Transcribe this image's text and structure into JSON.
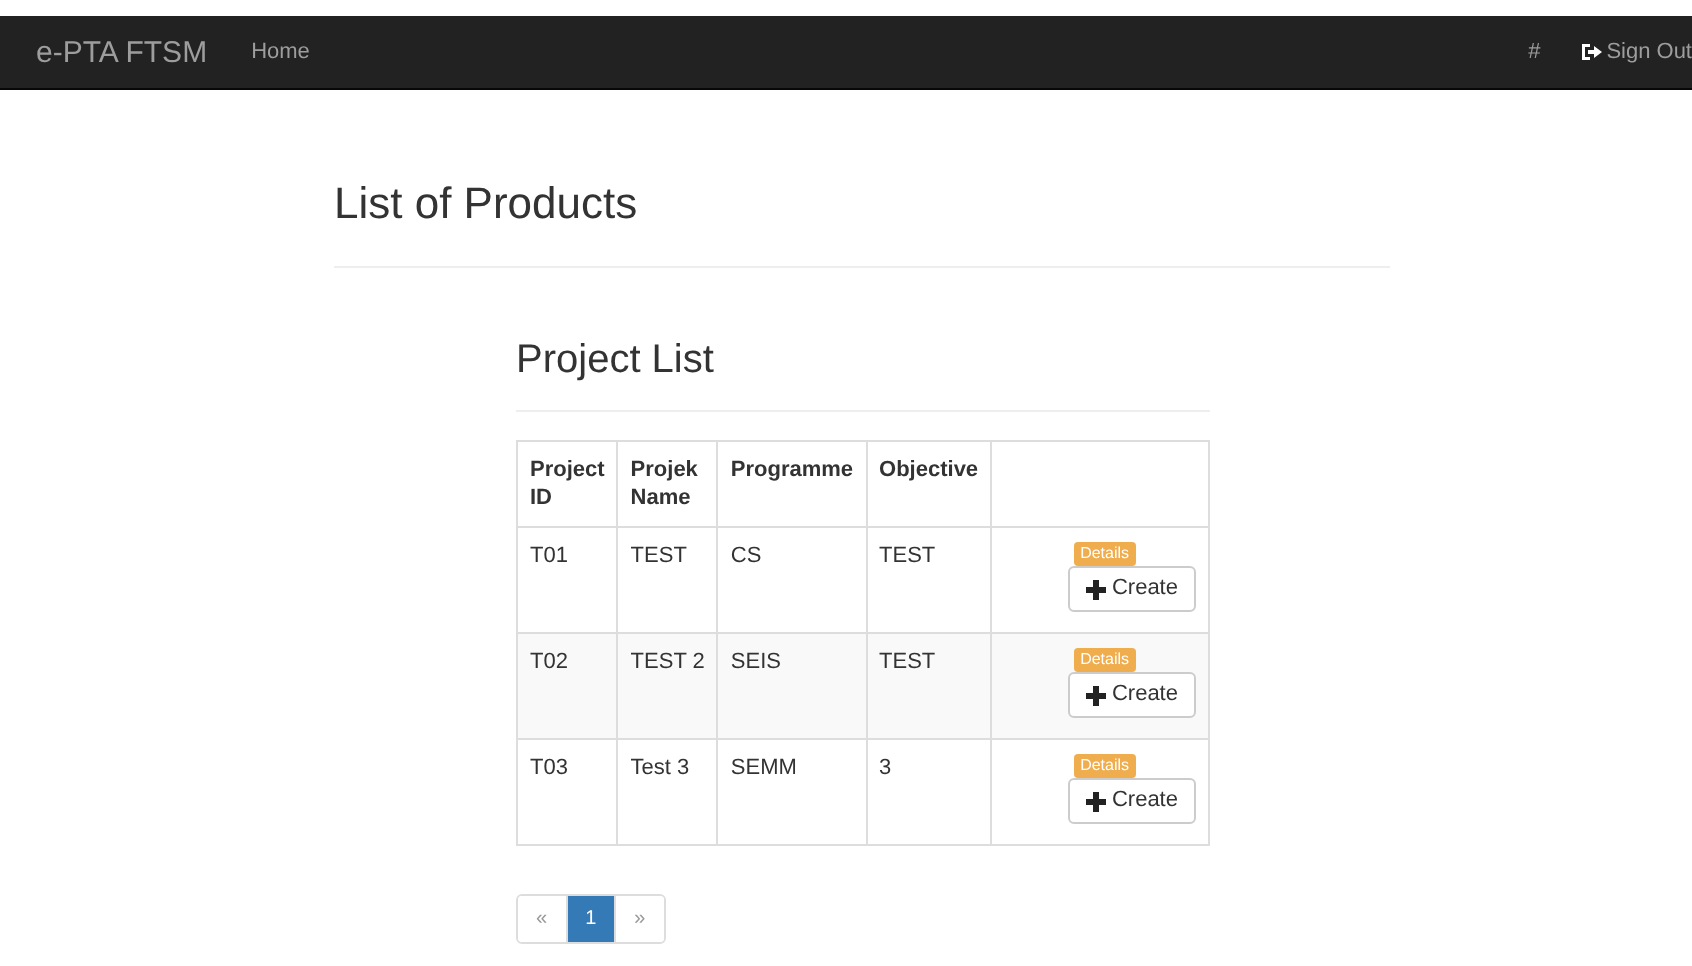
{
  "navbar": {
    "brand": "e-PTA FTSM",
    "links": [
      "Home"
    ],
    "right_links": [
      {
        "kind": "text",
        "label": "#"
      },
      {
        "kind": "signout",
        "label": "Sign Out"
      }
    ]
  },
  "page_title": "List of Products",
  "section_title": "Project List",
  "table": {
    "columns": [
      "Project ID",
      "Projek Name",
      "Programme",
      "Objective"
    ],
    "rows": [
      {
        "cells": [
          "T01",
          "TEST",
          "CS",
          "TEST"
        ],
        "badge": "Details",
        "button": "Create"
      },
      {
        "cells": [
          "T02",
          "TEST 2",
          "SEIS",
          "TEST"
        ],
        "badge": "Details",
        "button": "Create"
      },
      {
        "cells": [
          "T03",
          "Test 3",
          "SEMM",
          "3"
        ],
        "badge": "Details",
        "button": "Create"
      }
    ]
  },
  "pagination": [
    {
      "label": "«",
      "selected": false
    },
    {
      "label": "1",
      "selected": true
    },
    {
      "label": "»",
      "selected": false
    }
  ]
}
